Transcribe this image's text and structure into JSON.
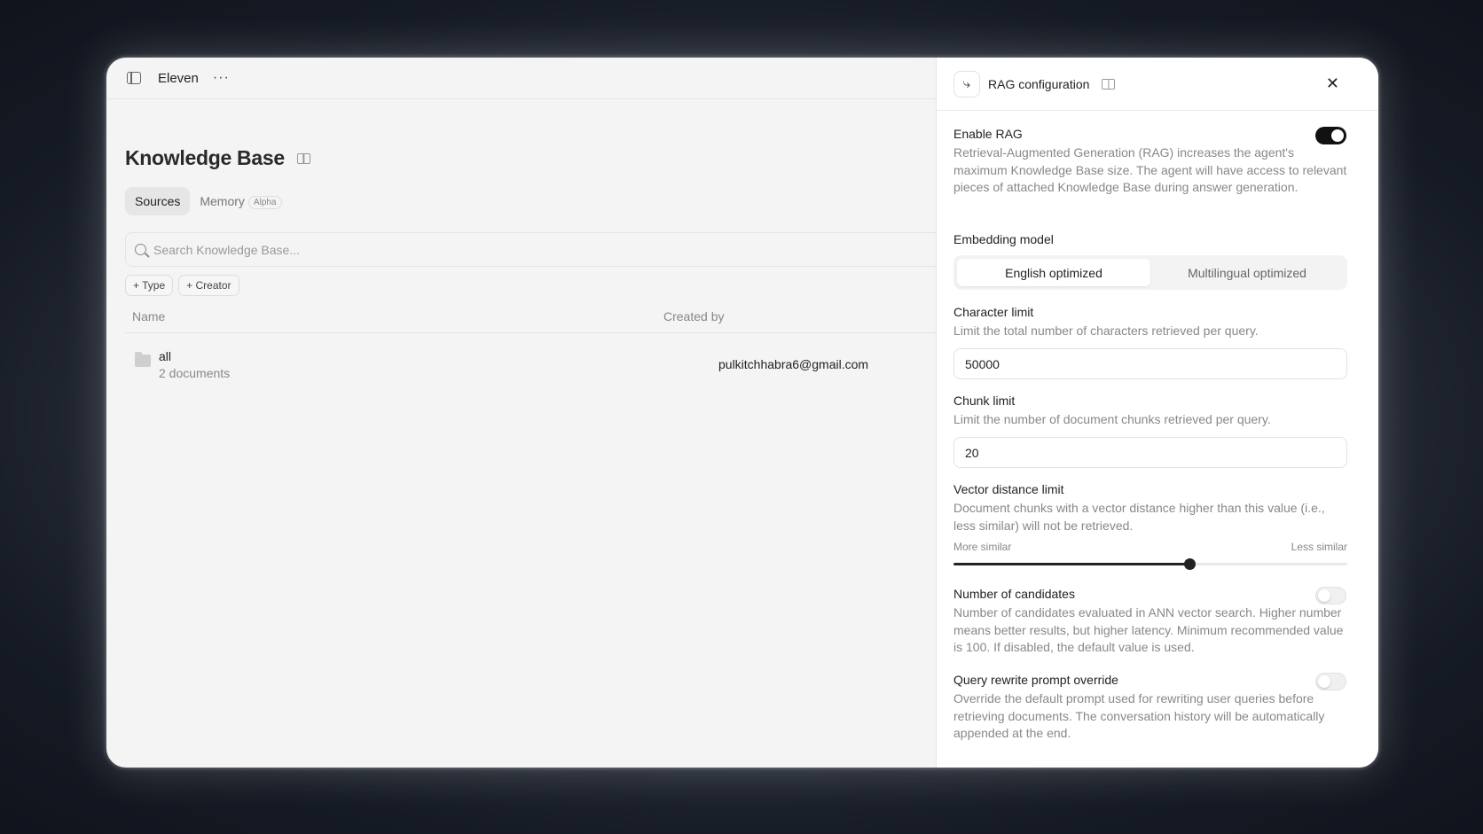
{
  "topbar": {
    "workspace": "Eleven",
    "more": "···"
  },
  "kb": {
    "title": "Knowledge Base",
    "tabs": [
      {
        "label": "Sources"
      },
      {
        "label": "Memory",
        "badge": "Alpha"
      }
    ],
    "search_placeholder": "Search Knowledge Base...",
    "filters": [
      "+ Type",
      "+ Creator"
    ],
    "columns": {
      "name": "Name",
      "created_by": "Created by"
    },
    "rows": [
      {
        "name": "all",
        "sub": "2 documents",
        "creator": "pulkitchhabra6@gmail.com"
      }
    ]
  },
  "panel": {
    "title": "RAG configuration",
    "close": "✕",
    "enable_rag": {
      "label": "Enable RAG",
      "desc": "Retrieval-Augmented Generation (RAG) increases the agent's maximum Knowledge Base size. The agent will have access to relevant pieces of attached Knowledge Base during answer generation.",
      "enabled": true
    },
    "embedding": {
      "label": "Embedding model",
      "options": [
        "English optimized",
        "Multilingual optimized"
      ],
      "selected": "English optimized"
    },
    "char_limit": {
      "label": "Character limit",
      "desc": "Limit the total number of characters retrieved per query.",
      "value": "50000"
    },
    "chunk_limit": {
      "label": "Chunk limit",
      "desc": "Limit the number of document chunks retrieved per query.",
      "value": "20"
    },
    "vector": {
      "label": "Vector distance limit",
      "desc": "Document chunks with a vector distance higher than this value (i.e., less similar) will not be retrieved.",
      "left_label": "More similar",
      "right_label": "Less similar",
      "fraction": 0.6
    },
    "candidates": {
      "label": "Number of candidates",
      "desc": "Number of candidates evaluated in ANN vector search. Higher number means better results, but higher latency. Minimum recommended value is 100. If disabled, the default value is used.",
      "enabled": false
    },
    "query_rewrite": {
      "label": "Query rewrite prompt override",
      "desc": "Override the default prompt used for rewriting user queries before retrieving documents. The conversation history will be automatically appended at the end.",
      "enabled": false
    }
  }
}
